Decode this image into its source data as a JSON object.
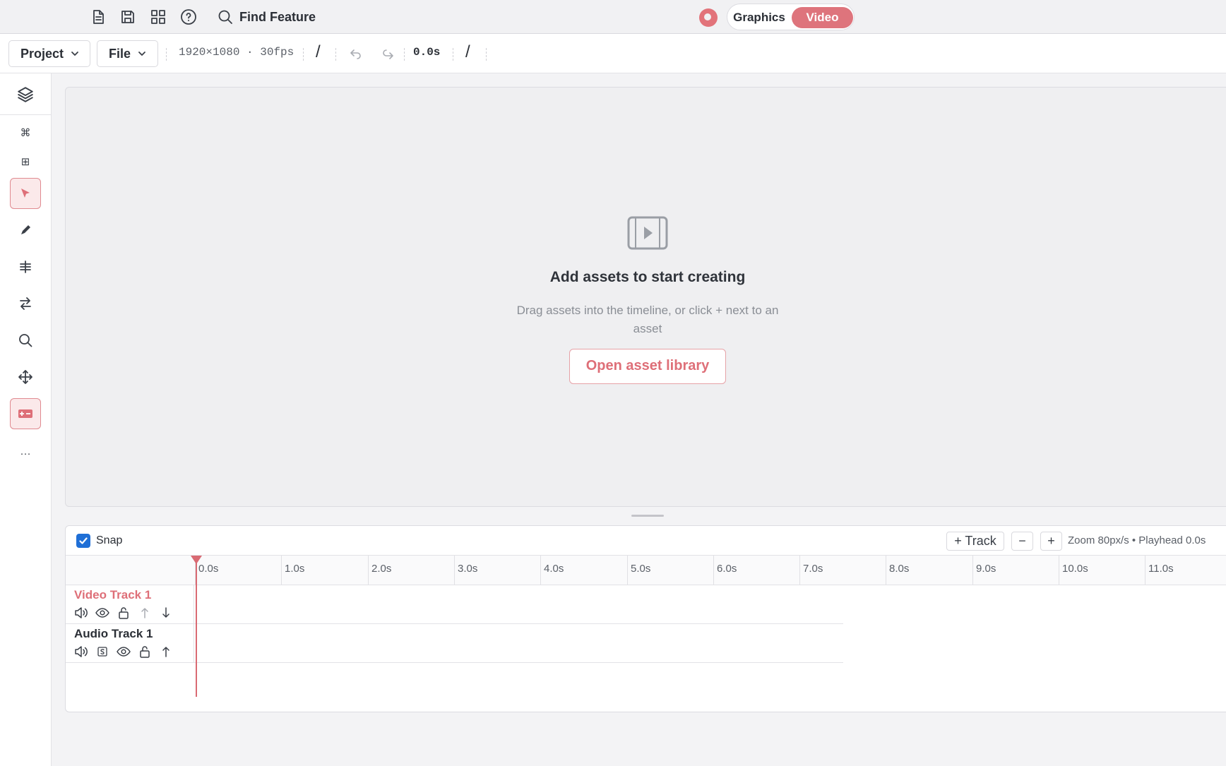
{
  "topbar": {
    "icons": [
      "new-file-icon",
      "save-icon",
      "grid-icon",
      "help-icon",
      "search-icon"
    ],
    "find_feature": "Find Feature",
    "mode": {
      "graphics": "Graphics",
      "video": "Video",
      "active": "Video"
    }
  },
  "toolbar": {
    "project_label": "Project",
    "file_label": "File",
    "resolution": "1920×1080 · 30fps",
    "slash": "/",
    "timecode": "0.0s"
  },
  "leftrail": {
    "items": [
      {
        "icon": "layers-icon",
        "glyph": ""
      },
      {
        "icon": "command-icon",
        "glyph": "⌘"
      },
      {
        "icon": "grid-small-icon",
        "glyph": "⊞"
      },
      {
        "icon": "select-cursor-icon",
        "active": true
      },
      {
        "icon": "pen-icon"
      },
      {
        "icon": "align-icon"
      },
      {
        "icon": "swap-icon"
      },
      {
        "icon": "search-icon"
      },
      {
        "icon": "move-icon"
      },
      {
        "icon": "add-card-icon",
        "active": true
      },
      {
        "icon": "more-icon",
        "glyph": "···"
      }
    ]
  },
  "preview": {
    "title": "Add assets to start creating",
    "description": "Drag assets into the timeline, or click + next to an asset",
    "button": "Open asset library"
  },
  "timeline": {
    "snap_label": "Snap",
    "snap_checked": true,
    "add_track": "+ Track",
    "zoom_out": "−",
    "zoom_in": "+",
    "zoom_info": "Zoom 80px/s  •  Playhead 0.0s",
    "ruler_labels": [
      "0.0s",
      "1.0s",
      "2.0s",
      "3.0s",
      "4.0s",
      "5.0s",
      "6.0s",
      "7.0s",
      "8.0s",
      "9.0s",
      "10.0s",
      "11.0s"
    ],
    "tracks": [
      {
        "name": "Video Track 1",
        "color": "#de6f78",
        "controls": [
          "volume-icon",
          "eye-icon",
          "lock-open-icon",
          "arrow-up-icon",
          "arrow-down-icon"
        ]
      },
      {
        "name": "Audio Track 1",
        "color": "#2b2f36",
        "controls": [
          "volume-icon",
          "solo-icon",
          "eye-icon",
          "lock-open-icon",
          "arrow-up-icon"
        ]
      }
    ],
    "playhead_seconds": 0.0
  },
  "colors": {
    "accent": "#de747c",
    "accent_text": "#de6f78",
    "checkbox": "#1f6fd6"
  }
}
